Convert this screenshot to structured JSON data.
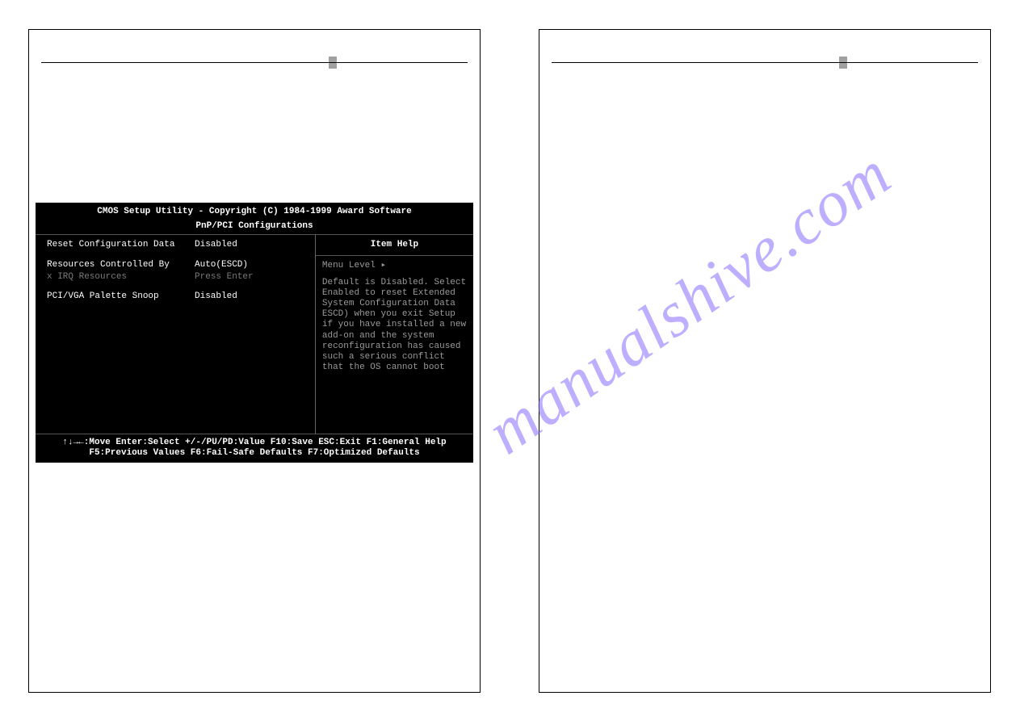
{
  "watermark": "manualshive.com",
  "bios": {
    "title": "CMOS Setup Utility - Copyright (C) 1984-1999 Award Software",
    "subtitle": "PnP/PCI Configurations",
    "options": [
      {
        "label": "Reset Configuration Data",
        "value": "Disabled",
        "dim": false
      },
      {
        "label": "Resources Controlled By",
        "value": "Auto(ESCD)",
        "dim": false,
        "gap_before": true
      },
      {
        "label": "x IRQ Resources",
        "value": "Press Enter",
        "dim": true
      },
      {
        "label": "PCI/VGA Palette Snoop",
        "value": "Disabled",
        "dim": false,
        "gap_before": true
      }
    ],
    "help_header": "Item Help",
    "menu_level": "Menu Level   ▸",
    "help_text": "Default is Disabled. Select Enabled to reset Extended System Configuration Data ESCD) when you exit Setup if you have installed a new add-on and the system reconfiguration has caused such a serious conflict that the OS cannot boot",
    "footer_line1": "↑↓→←:Move  Enter:Select  +/-/PU/PD:Value  F10:Save   ESC:Exit  F1:General Help",
    "footer_line2": "F5:Previous Values    F6:Fail-Safe Defaults    F7:Optimized Defaults"
  }
}
